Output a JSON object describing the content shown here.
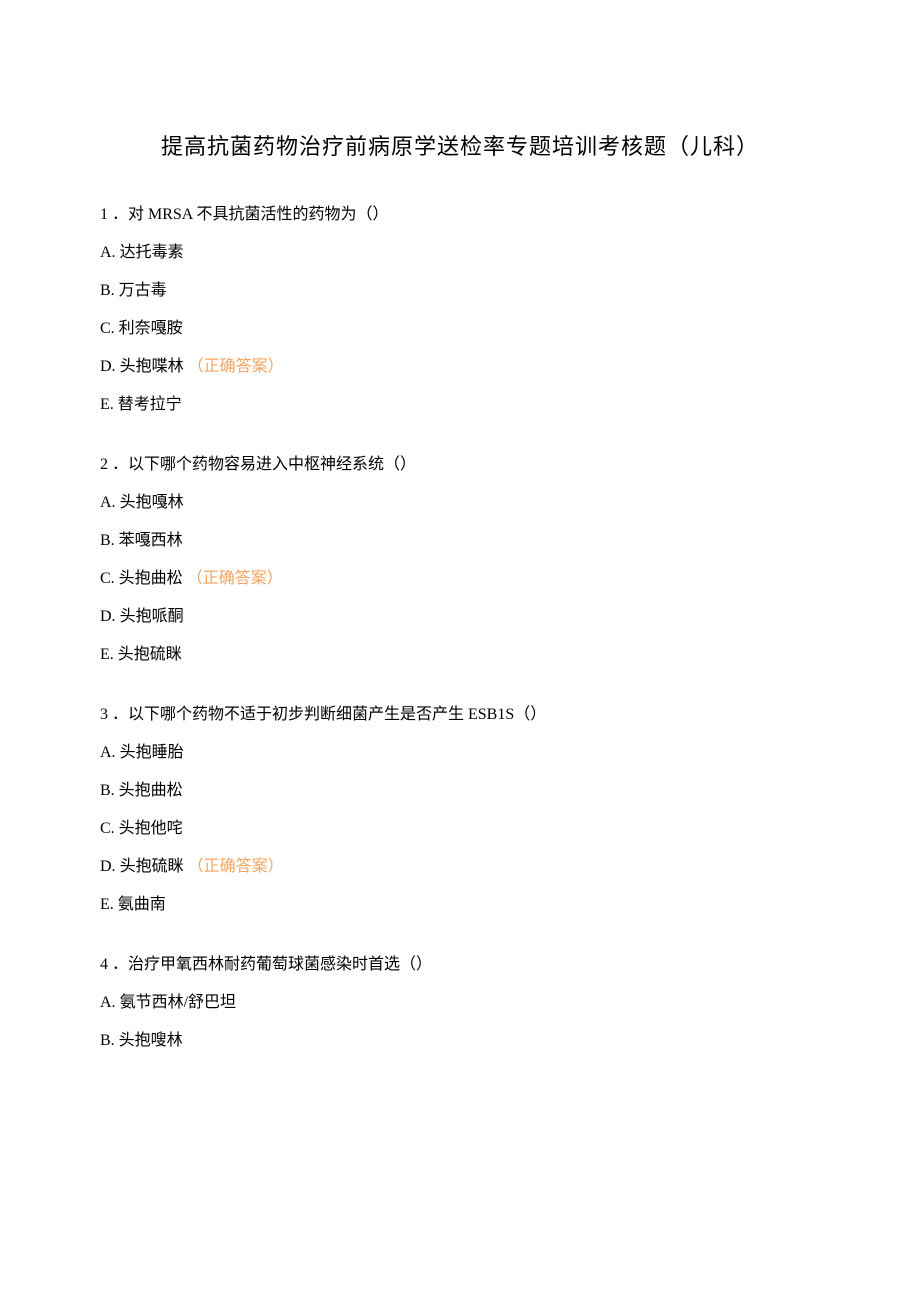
{
  "title": "提高抗菌药物治疗前病原学送检率专题培训考核题（儿科）",
  "correct_label": "（正确答案）",
  "questions": [
    {
      "num": "1",
      "stem": "．对 MRSA 不具抗菌活性的药物为（）",
      "options": [
        {
          "label": "A.",
          "text": "达托毒素",
          "correct": false
        },
        {
          "label": "B.",
          "text": "万古毒",
          "correct": false
        },
        {
          "label": "C.",
          "text": "利奈嘎胺",
          "correct": false
        },
        {
          "label": "D.",
          "text": "头抱喋林",
          "correct": true
        },
        {
          "label": "E.",
          "text": "替考拉宁",
          "correct": false
        }
      ]
    },
    {
      "num": "2",
      "stem": "．以下哪个药物容易进入中枢神经系统（）",
      "options": [
        {
          "label": "A.",
          "text": "头抱嘎林",
          "correct": false
        },
        {
          "label": "B.",
          "text": "苯嘎西林",
          "correct": false
        },
        {
          "label": "C.",
          "text": "头抱曲松",
          "correct": true
        },
        {
          "label": "D.",
          "text": "头抱哌酮",
          "correct": false
        },
        {
          "label": "E.",
          "text": "头抱硫眯",
          "correct": false
        }
      ]
    },
    {
      "num": "3",
      "stem": "．以下哪个药物不适于初步判断细菌产生是否产生 ESB1S（）",
      "options": [
        {
          "label": "A.",
          "text": "头抱睡胎",
          "correct": false
        },
        {
          "label": "B.",
          "text": "头抱曲松",
          "correct": false
        },
        {
          "label": "C.",
          "text": "头抱他咤",
          "correct": false
        },
        {
          "label": "D.",
          "text": "头抱硫眯",
          "correct": true
        },
        {
          "label": "E.",
          "text": "氨曲南",
          "correct": false
        }
      ]
    },
    {
      "num": "4",
      "stem": "．治疗甲氧西林耐药葡萄球菌感染时首选（）",
      "options": [
        {
          "label": "A.",
          "text": "氨节西林/舒巴坦",
          "correct": false
        },
        {
          "label": "B.",
          "text": "头抱嗖林",
          "correct": false
        }
      ]
    }
  ]
}
